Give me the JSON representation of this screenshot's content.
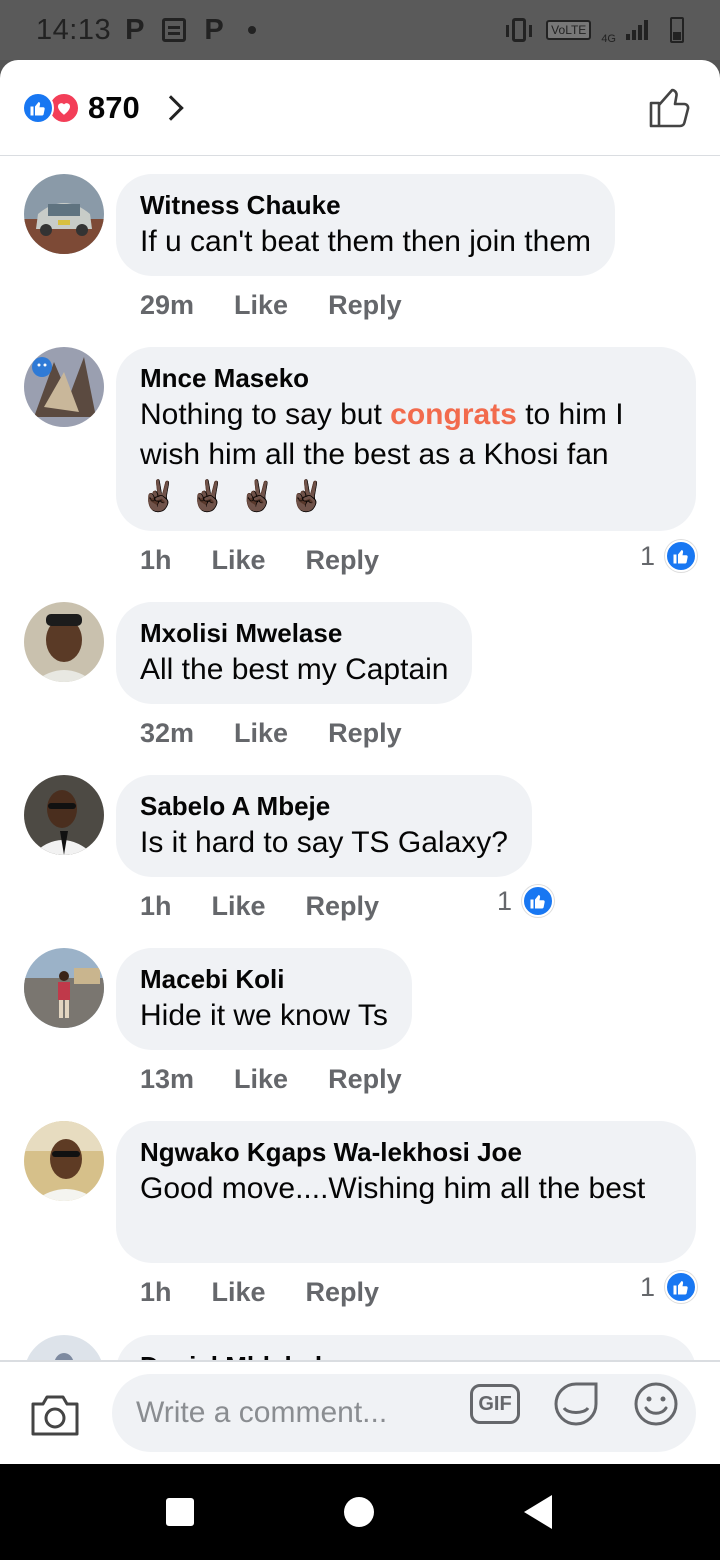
{
  "status_bar": {
    "time": "14:13",
    "left_icons": [
      "p-app-icon",
      "news-icon",
      "p-app-icon",
      "dot-icon"
    ],
    "p_letter": "P",
    "volte": "VoLTE",
    "network": "4G"
  },
  "header": {
    "reaction_count": "870",
    "reactions": [
      "like-icon",
      "love-icon"
    ]
  },
  "comments": [
    {
      "name": "Witness Chauke",
      "text": "If u can't beat them then join them",
      "time": "29m",
      "like": "Like",
      "reply": "Reply",
      "likes": ""
    },
    {
      "name": "Mnce Maseko",
      "text_before": "Nothing to say but ",
      "highlight": "congrats",
      "text_after": " to him I wish him all the best as a Khosi fan",
      "emoji": [
        "✌🏿",
        "✌🏿",
        "✌🏿",
        "✌🏿"
      ],
      "time": "1h",
      "like": "Like",
      "reply": "Reply",
      "likes": "1"
    },
    {
      "name": "Mxolisi Mwelase",
      "text": "All the best my Captain",
      "time": "32m",
      "like": "Like",
      "reply": "Reply",
      "likes": ""
    },
    {
      "name": "Sabelo A Mbeje",
      "text": "Is it hard to say TS Galaxy?",
      "time": "1h",
      "like": "Like",
      "reply": "Reply",
      "likes": "1"
    },
    {
      "name": "Macebi Koli",
      "text": "Hide it we know Ts",
      "time": "13m",
      "like": "Like",
      "reply": "Reply",
      "likes": ""
    },
    {
      "name": "Ngwako Kgaps Wa-lekhosi Joe",
      "text": "Good move....Wishing him all the best",
      "time": "1h",
      "like": "Like",
      "reply": "Reply",
      "likes": "1"
    },
    {
      "name": "Daniel Mhlabeh"
    }
  ],
  "composer": {
    "placeholder": "Write a comment...",
    "gif_label": "GIF"
  },
  "colors": {
    "accent": "#1877f2",
    "love": "#f33e58",
    "highlight": "#f26b4d",
    "bubble": "#f0f2f5",
    "secondary_text": "#65676b"
  }
}
